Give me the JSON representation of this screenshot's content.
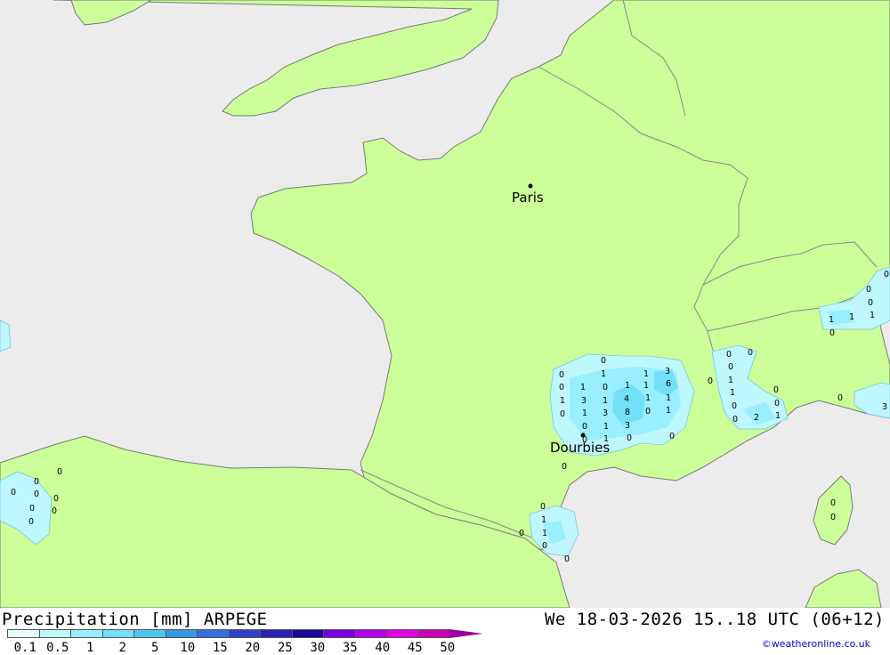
{
  "title": "Precipitation [mm] ARPEGE",
  "time_label": "We 18-03-2026 15..18 UTC (06+12)",
  "credit": "©weatheronline.co.uk",
  "colors": {
    "sea": "#ececec",
    "land": "#ccff99",
    "border": "#888888",
    "coast": "#7a7a7a"
  },
  "legend": {
    "labels": [
      "0.1",
      "0.5",
      "1",
      "2",
      "5",
      "10",
      "15",
      "20",
      "25",
      "30",
      "35",
      "40",
      "45",
      "50"
    ],
    "colors": [
      "#e6ffff",
      "#bff7ff",
      "#99eeff",
      "#73e0f7",
      "#4cc6ef",
      "#3399e6",
      "#3370dd",
      "#3340cc",
      "#2a22b3",
      "#1a0899",
      "#7a00e0",
      "#b300e6",
      "#e000e6",
      "#cc00b3",
      "#a000a0"
    ]
  },
  "cities": [
    {
      "name": "Paris"
    },
    {
      "name": "Dourbies"
    }
  ],
  "value_labels": [
    "0",
    "1",
    "1",
    "3",
    "0",
    "1",
    "0",
    "1",
    "1",
    "6",
    "0",
    "1",
    "3",
    "1",
    "4",
    "1",
    "1",
    "0",
    "1",
    "3",
    "8",
    "0",
    "1",
    "0",
    "1",
    "3",
    "0",
    "1",
    "0",
    "0",
    "0",
    "0",
    "0",
    "0",
    "1",
    "1",
    "0",
    "0",
    "0",
    "2",
    "1",
    "0",
    "0",
    "0",
    "3",
    "0",
    "0",
    "0",
    "1",
    "1",
    "1",
    "0",
    "0",
    "0",
    "1",
    "1",
    "0",
    "0",
    "0",
    "0",
    "0",
    "0",
    "0",
    "0",
    "0",
    "0",
    "0",
    "0"
  ]
}
